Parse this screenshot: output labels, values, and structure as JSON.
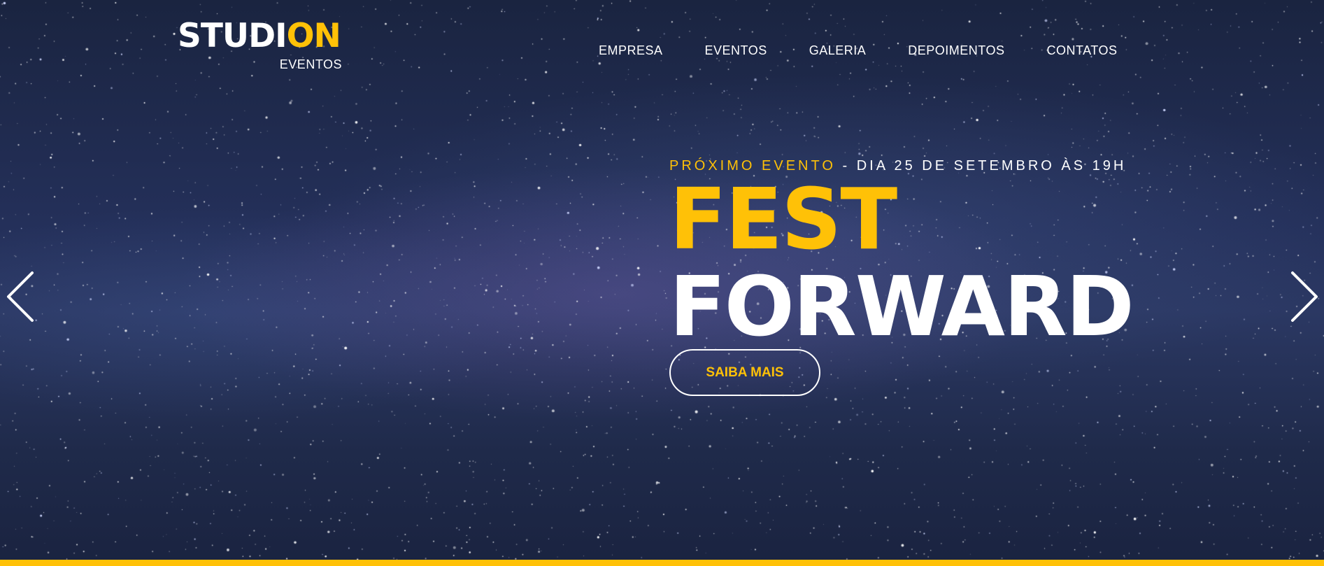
{
  "logo": {
    "main": "STUDI",
    "accent": "ON",
    "subtitle": "EVENTOS"
  },
  "nav": {
    "items": [
      "EMPRESA",
      "EVENTOS",
      "GALERIA",
      "DEPOIMENTOS",
      "CONTATOS"
    ]
  },
  "hero": {
    "next_event_label": "PRÓXIMO EVENTO",
    "separator": "-",
    "next_event_date": "DIA 25 DE SETEMBRO ÀS 19H",
    "title_line1": "FEST",
    "title_line2": "FORWARD",
    "cta_label": "SAIBA MAIS"
  },
  "controls": {
    "prev_icon": "chevron-left-icon",
    "next_icon": "chevron-right-icon"
  },
  "colors": {
    "accent": "#ffc107",
    "text": "#ffffff",
    "background": "#1f2a4a"
  }
}
